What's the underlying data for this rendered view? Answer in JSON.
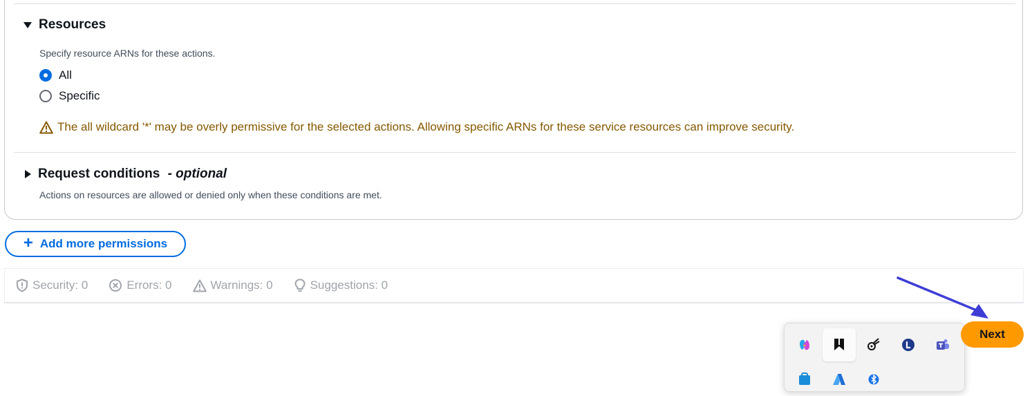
{
  "resources": {
    "title": "Resources",
    "description": "Specify resource ARNs for these actions.",
    "options": [
      {
        "label": "All",
        "selected": true
      },
      {
        "label": "Specific",
        "selected": false
      }
    ],
    "warning": "The all wildcard '*' may be overly permissive for the selected actions. Allowing specific ARNs for these service resources can improve security."
  },
  "request_conditions": {
    "title": "Request conditions",
    "optional_label": "- optional",
    "description": "Actions on resources are allowed or denied only when these conditions are met."
  },
  "add_more_permissions_label": "Add more permissions",
  "status": {
    "security": "Security: 0",
    "errors": "Errors: 0",
    "warnings": "Warnings: 0",
    "suggestions": "Suggestions: 0"
  },
  "next_label": "Next",
  "tray": {
    "icons": [
      "copilot-icon",
      "app-icon",
      "snipping-tool-icon",
      "l-app-icon",
      "teams-icon",
      "store-icon",
      "azure-icon",
      "bluetooth-icon"
    ]
  },
  "colors": {
    "primary": "#006ce0",
    "accent": "#ff9900",
    "warning": "#855900",
    "muted": "#a0a4ab",
    "annotation_arrow": "#3d3dd6"
  }
}
